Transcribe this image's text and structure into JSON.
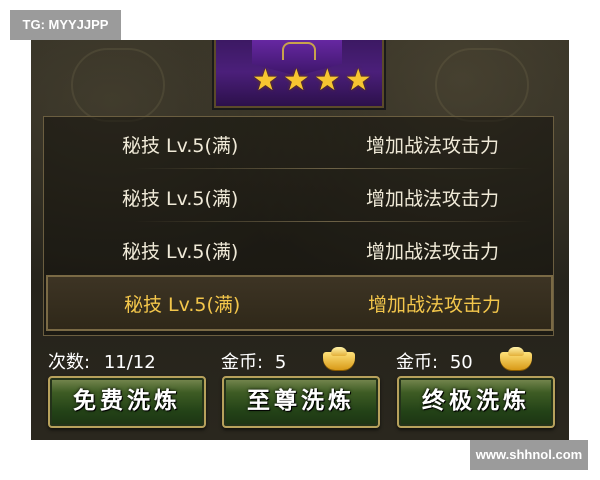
{
  "watermarks": {
    "top_left": "TG: MYYJJPP",
    "bottom_right": "www.shhnol.com"
  },
  "skill_card": {
    "star_rating": 4,
    "star_glyph": "★",
    "card_color": "#4b1f7a"
  },
  "attributes": [
    {
      "name": "秘技 Lv.5(满)",
      "effect": "增加战法攻击力",
      "selected": false
    },
    {
      "name": "秘技 Lv.5(满)",
      "effect": "增加战法攻击力",
      "selected": false
    },
    {
      "name": "秘技 Lv.5(满)",
      "effect": "增加战法攻击力",
      "selected": false
    },
    {
      "name": "秘技 Lv.5(满)",
      "effect": "增加战法攻击力",
      "selected": true
    }
  ],
  "costs": {
    "free": {
      "label": "次数:",
      "value": "11/12"
    },
    "supreme": {
      "label": "金币:",
      "value": "5",
      "icon": "gold-ingot-icon"
    },
    "ultimate": {
      "label": "金币:",
      "value": "50",
      "icon": "gold-ingot-icon"
    }
  },
  "buttons": {
    "free": "免费洗炼",
    "supreme": "至尊洗炼",
    "ultimate": "终极洗炼"
  },
  "colors": {
    "selected_text": "#f3c64b",
    "normal_text": "#f0ead8",
    "button_green": "#234217",
    "star_gold": "#f7c531"
  }
}
